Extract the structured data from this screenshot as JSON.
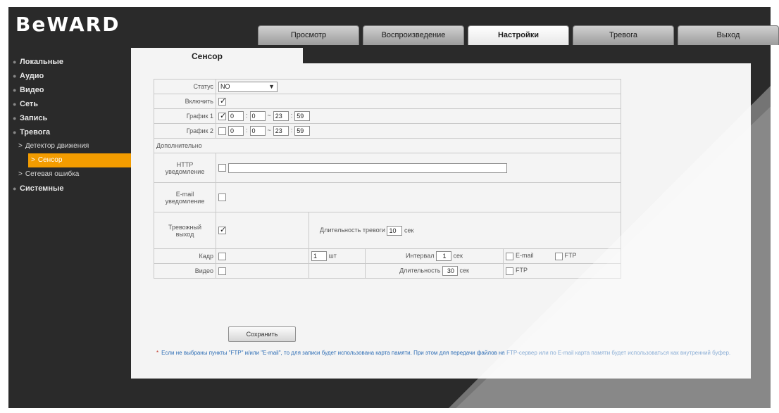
{
  "logo": "BeWARD",
  "nav": {
    "tabs": [
      {
        "label": "Просмотр",
        "active": false
      },
      {
        "label": "Воспроизведение",
        "active": false
      },
      {
        "label": "Настройки",
        "active": true
      },
      {
        "label": "Тревога",
        "active": false
      },
      {
        "label": "Выход",
        "active": false
      }
    ]
  },
  "sidebar": {
    "items": [
      {
        "label": "Локальные",
        "type": "item"
      },
      {
        "label": "Аудио",
        "type": "item"
      },
      {
        "label": "Видео",
        "type": "item"
      },
      {
        "label": "Сеть",
        "type": "item"
      },
      {
        "label": "Запись",
        "type": "item"
      },
      {
        "label": "Тревога",
        "type": "item"
      },
      {
        "label": "Детектор движения",
        "type": "sub",
        "active": false
      },
      {
        "label": "Сенсор",
        "type": "sub",
        "active": true
      },
      {
        "label": "Сетевая ошибка",
        "type": "sub",
        "active": false
      },
      {
        "label": "Системные",
        "type": "item"
      }
    ]
  },
  "page": {
    "subtab": "Сенсор",
    "rows": {
      "status": {
        "label": "Статус",
        "value": "NO"
      },
      "enable": {
        "label": "Включить",
        "checked": true
      },
      "schedule1": {
        "label": "График 1",
        "checked": true,
        "from_h": "0",
        "from_m": "0",
        "to_h": "23",
        "to_m": "59"
      },
      "schedule2": {
        "label": "График 2",
        "checked": false,
        "from_h": "0",
        "from_m": "0",
        "to_h": "23",
        "to_m": "59"
      },
      "extra": {
        "label": "Дополнительно"
      },
      "http": {
        "label_top": "HTTP",
        "label_bottom": "уведомление",
        "checked": false,
        "value": ""
      },
      "email": {
        "label_top": "E-mail",
        "label_bottom": "уведомление",
        "checked": false
      },
      "alarm_out": {
        "label_top": "Тревожный",
        "label_bottom": "выход",
        "checked": true,
        "duration_label": "Длительность тревоги",
        "duration_value": "10",
        "duration_unit": "сек"
      },
      "frame": {
        "label": "Кадр",
        "checked": false,
        "count": "1",
        "count_unit": "шт",
        "interval_label": "Интервал",
        "interval_value": "1",
        "interval_unit": "сек",
        "email_label": "E-mail",
        "email_checked": false,
        "ftp_label": "FTP",
        "ftp_checked": false
      },
      "video": {
        "label": "Видео",
        "checked": false,
        "duration_label": "Длительность",
        "duration_value": "30",
        "duration_unit": "сек",
        "ftp_label": "FTP",
        "ftp_checked": false
      }
    },
    "save_button": "Сохранить",
    "note": "Если не выбраны пункты \"FTP\" и/или \"E-mail\", то для записи будет использована карта памяти. При этом для передачи файлов на FTP-сервер или по E-mail карта памяти будет использоваться как внутренний буфер."
  },
  "colors": {
    "background": "#2a2a2a",
    "accent": "#f39c00",
    "panel": "#f4f4f4",
    "note": "#2d6db5"
  }
}
